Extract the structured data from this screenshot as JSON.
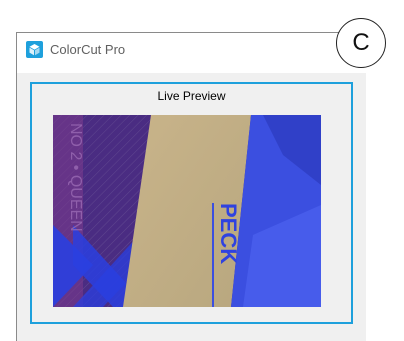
{
  "window": {
    "title": "ColorCut Pro",
    "app_icon": "cube-icon"
  },
  "preview": {
    "label": "Live Preview",
    "overlay_text_left": "NO 2 • QUEEN",
    "overlay_text_right": "PECK"
  },
  "badge": {
    "label": "C"
  },
  "colors": {
    "accent": "#1ea0dc",
    "frame_bg": "#f0f0f0"
  }
}
